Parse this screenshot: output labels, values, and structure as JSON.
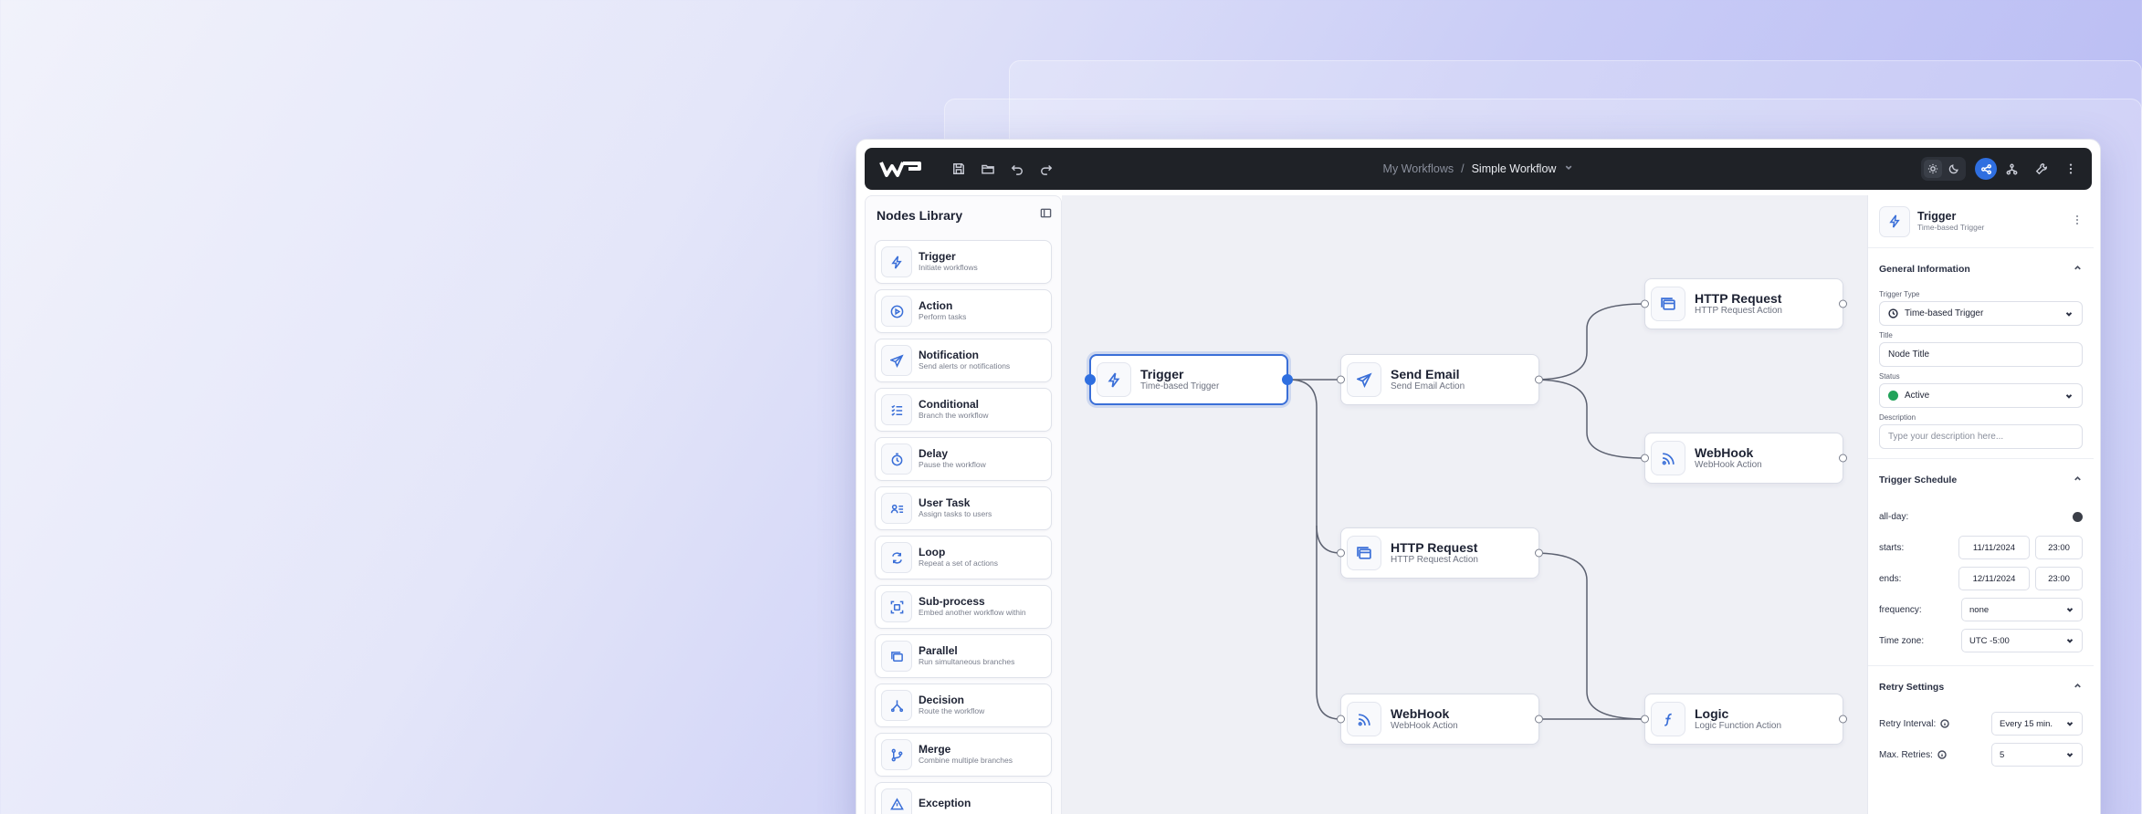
{
  "topbar": {
    "breadcrumb_parent": "My Workflows",
    "breadcrumb_separator": "/",
    "breadcrumb_current": "Simple Workflow"
  },
  "sidebar": {
    "title": "Nodes Library",
    "items": [
      {
        "name": "Trigger",
        "desc": "Initiate workflows",
        "icon": "bolt-icon"
      },
      {
        "name": "Action",
        "desc": "Perform tasks",
        "icon": "play-circle-icon"
      },
      {
        "name": "Notification",
        "desc": "Send alerts or notifications",
        "icon": "send-icon"
      },
      {
        "name": "Conditional",
        "desc": "Branch the workflow",
        "icon": "checklist-icon"
      },
      {
        "name": "Delay",
        "desc": "Pause the workflow",
        "icon": "timer-icon"
      },
      {
        "name": "User Task",
        "desc": "Assign tasks to users",
        "icon": "user-list-icon"
      },
      {
        "name": "Loop",
        "desc": "Repeat a set of actions",
        "icon": "loop-icon"
      },
      {
        "name": "Sub-process",
        "desc": "Embed another workflow within",
        "icon": "frame-icon"
      },
      {
        "name": "Parallel",
        "desc": "Run simultaneous branches",
        "icon": "layers-icon"
      },
      {
        "name": "Decision",
        "desc": "Route the workflow",
        "icon": "split-icon"
      },
      {
        "name": "Merge",
        "desc": "Combine multiple branches",
        "icon": "merge-icon"
      },
      {
        "name": "Exception",
        "desc": "",
        "icon": "warning-icon"
      }
    ]
  },
  "canvas": {
    "nodes": [
      {
        "id": "trigger",
        "name": "Trigger",
        "desc": "Time-based Trigger",
        "icon": "bolt-icon"
      },
      {
        "id": "send-email",
        "name": "Send Email",
        "desc": "Send Email Action",
        "icon": "send-icon"
      },
      {
        "id": "http-1",
        "name": "HTTP Request",
        "desc": "HTTP Request Action",
        "icon": "browser-icon"
      },
      {
        "id": "webhook-1",
        "name": "WebHook",
        "desc": "WebHook Action",
        "icon": "rss-icon"
      },
      {
        "id": "http-2",
        "name": "HTTP Request",
        "desc": "HTTP Request Action",
        "icon": "browser-icon"
      },
      {
        "id": "webhook-2",
        "name": "WebHook",
        "desc": "WebHook Action",
        "icon": "rss-icon"
      },
      {
        "id": "logic",
        "name": "Logic",
        "desc": "Logic Function Action",
        "icon": "function-icon"
      }
    ]
  },
  "properties": {
    "title": "Trigger",
    "subtitle": "Time-based Trigger",
    "general": {
      "section_title": "General Information",
      "trigger_type_label": "Trigger Type",
      "trigger_type_value": "Time-based Trigger",
      "title_label": "Title",
      "title_value": "Node Title",
      "status_label": "Status",
      "status_value": "Active",
      "status_color": "#22a35a",
      "description_label": "Description",
      "description_placeholder": "Type your description here..."
    },
    "schedule": {
      "section_title": "Trigger Schedule",
      "allday_label": "all-day:",
      "starts_label": "starts:",
      "starts_date": "11/11/2024",
      "starts_time": "23:00",
      "ends_label": "ends:",
      "ends_date": "12/11/2024",
      "ends_time": "23:00",
      "frequency_label": "frequency:",
      "frequency_value": "none",
      "timezone_label": "Time zone:",
      "timezone_value": "UTC -5:00"
    },
    "retry": {
      "section_title": "Retry Settings",
      "interval_label": "Retry Interval:",
      "interval_value": "Every 15 min.",
      "max_label": "Max. Retries:",
      "max_value": "5"
    }
  },
  "colors": {
    "accent": "#2f6fe0",
    "topbar": "#1f2227",
    "icon_blue": "#3a6fd8"
  }
}
